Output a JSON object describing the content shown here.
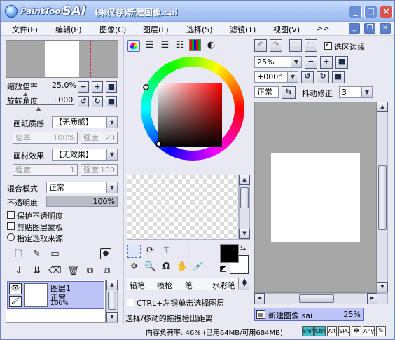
{
  "window": {
    "app_name": "PaintTool",
    "app_logo": "SAI",
    "title": "(未保存)新建图像.sai",
    "min": "_",
    "max": "□",
    "close": "×"
  },
  "menu": {
    "items": [
      "文件(F)",
      "编辑(E)",
      "图像(C)",
      "图层(L)",
      "选择(S)",
      "滤镜(T)",
      "视图(V)",
      ">>"
    ]
  },
  "nav": {
    "zoom_label": "缩放倍率",
    "zoom_value": "25.0%",
    "angle_label": "旋转角度",
    "angle_value": "+000"
  },
  "paper": {
    "texture_label": "画纸质感",
    "texture_value": "【无质感】",
    "texture_scale_label": "倍率",
    "texture_scale_value": "100%",
    "texture_strength_label": "强度",
    "texture_strength_value": "20",
    "effect_label": "画材效果",
    "effect_value": "【无效果】",
    "effect_degree_label": "程度",
    "effect_degree_value": "1",
    "effect_strength_label": "强度",
    "effect_strength_value": "100"
  },
  "layer_props": {
    "blend_label": "混合模式",
    "blend_value": "正常",
    "opacity_label": "不透明度",
    "opacity_value": "100%",
    "opacity_fraction": 1.0,
    "preserve_opacity": "保护不透明度",
    "clip_group": "剪贴图层蒙板",
    "select_source": "指定选取来源"
  },
  "layers": [
    {
      "name": "图层1",
      "mode": "正常",
      "opacity": "100%"
    }
  ],
  "color": {
    "hue_ring_colors": [
      "#ff0000",
      "#ffff00",
      "#00ff00",
      "#00ffff",
      "#0000ff",
      "#ff00ff"
    ],
    "square_hue": "#ff0000",
    "primary": "#000000",
    "secondary": "#ffffff"
  },
  "tools": {
    "brush_tabs": [
      "铅笔",
      "喷枪",
      "笔",
      "水彩笔"
    ],
    "ctrl_click_label": "CTRL+左键单击选择图层",
    "hint": "选择/移动的拖拽检出距离"
  },
  "view_panel": {
    "edge_label": "选区边缘",
    "zoom_value": "25%",
    "angle_value": "+000°",
    "mode_value": "正常",
    "stabilizer_label": "抖动修正",
    "stabilizer_value": "3"
  },
  "canvas_tab": {
    "name": "新建图像.sai",
    "zoom": "25%"
  },
  "status": {
    "memory": "内存负荷率: 46% (已用64MB/可用684MB)",
    "keys": [
      "Shift",
      "Ctrl",
      "Alt",
      "SPC",
      "Any"
    ]
  }
}
